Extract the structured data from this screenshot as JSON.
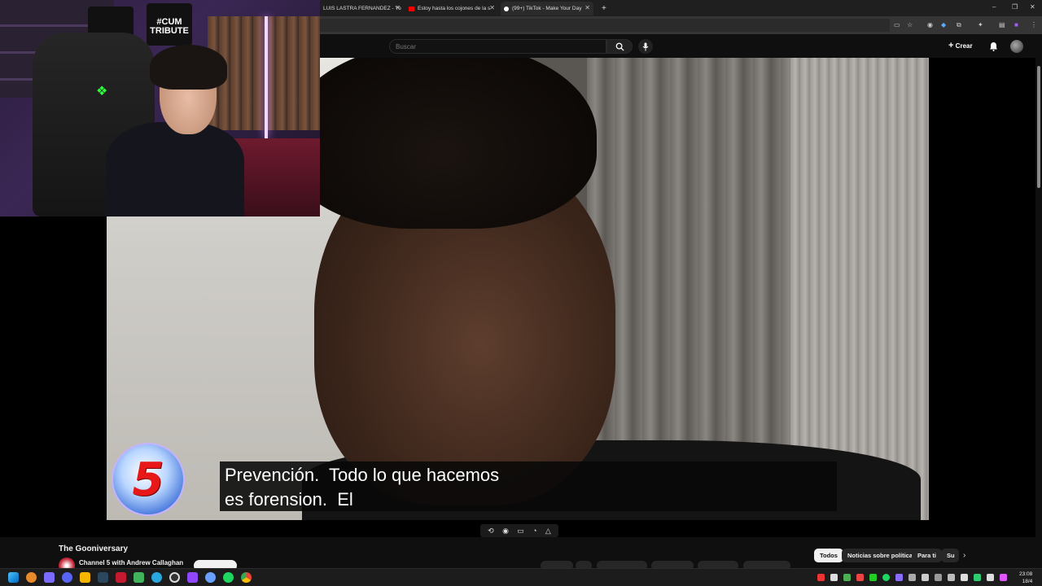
{
  "browser": {
    "tabs": [
      {
        "label": "LUIS LASTRA FERNANDEZ - Yo",
        "favicon_color": "#ff0000"
      },
      {
        "label": "Estoy hasta los cojones de la s",
        "favicon_color": "#ff0000"
      },
      {
        "label": "(99+) TikTok - Make Your Day",
        "favicon_color": "#ffffff"
      }
    ],
    "new_tab": "+",
    "close_glyph": "✕",
    "window_controls": {
      "minimize": "–",
      "maximize": "❐",
      "close": "✕"
    }
  },
  "youtube": {
    "search_placeholder": "Buscar",
    "create_label": "Crear",
    "video_title": "The Gooniversary",
    "channel_name": "Channel 5 with Andrew Callaghan",
    "chips": [
      "Todos",
      "Noticias sobre política",
      "Para ti",
      "Su"
    ],
    "active_chip": "Todos"
  },
  "video": {
    "logo_text": "5",
    "caption_line1": "Prevención.  Todo lo que hacemos",
    "caption_line2": "es forension.  El"
  },
  "webcam": {
    "shirt_text": "#CUM TRIBUTE"
  },
  "taskbar": {
    "time": "23:08",
    "date": "18/4"
  },
  "colors": {
    "yt_background": "#0f0f0f",
    "chip_active": "#f1f1f1",
    "accent_red": "#ff0000"
  }
}
